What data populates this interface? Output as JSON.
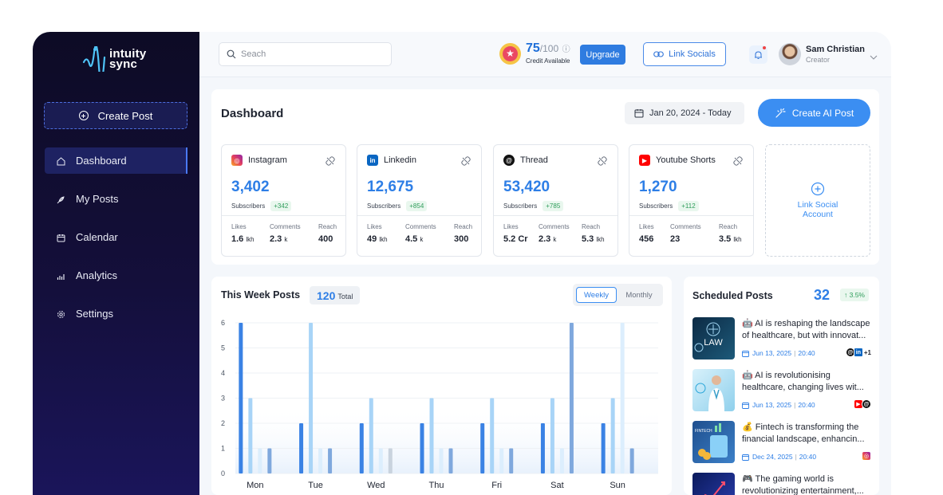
{
  "brand": {
    "name_line1": "intuity",
    "name_line2": "sync"
  },
  "sidebar": {
    "create_post_label": "Create Post",
    "items": [
      {
        "label": "Dashboard",
        "icon": "home-icon",
        "active": true
      },
      {
        "label": "My Posts",
        "icon": "feather-icon",
        "active": false
      },
      {
        "label": "Calendar",
        "icon": "calendar-icon",
        "active": false
      },
      {
        "label": "Analytics",
        "icon": "bar-chart-icon",
        "active": false
      },
      {
        "label": "Settings",
        "icon": "gear-icon",
        "active": false
      }
    ]
  },
  "header": {
    "search_placeholder": "Seach",
    "credits": {
      "value": "75",
      "total": "/100",
      "label": "Credit Available"
    },
    "upgrade_label": "Upgrade",
    "link_socials_label": "Link Socials",
    "user": {
      "name": "Sam Christian",
      "role": "Creator"
    }
  },
  "dashboard": {
    "title": "Dashboard",
    "date_range": "Jan 20, 2024 - Today",
    "create_ai_label": "Create AI Post",
    "link_social_label_1": "Link Social",
    "link_social_label_2": "Account",
    "cards": [
      {
        "platform": "Instagram",
        "icon": "instagram-icon",
        "color": "#e4405f",
        "count": "3,402",
        "sub": "Subscribers",
        "delta": "+342",
        "stats": [
          {
            "label": "Likes",
            "value": "1.6",
            "unit": "lkh"
          },
          {
            "label": "Comments",
            "value": "2.3",
            "unit": "k"
          },
          {
            "label": "Reach",
            "value": "400",
            "unit": ""
          }
        ]
      },
      {
        "platform": "Linkedin",
        "icon": "linkedin-icon",
        "color": "#0a66c2",
        "count": "12,675",
        "sub": "Subscribers",
        "delta": "+854",
        "stats": [
          {
            "label": "Likes",
            "value": "49",
            "unit": "lkh"
          },
          {
            "label": "Comments",
            "value": "4.5",
            "unit": "k"
          },
          {
            "label": "Reach",
            "value": "300",
            "unit": ""
          }
        ]
      },
      {
        "platform": "Thread",
        "icon": "threads-icon",
        "color": "#111111",
        "count": "53,420",
        "sub": "Subscribers",
        "delta": "+785",
        "stats": [
          {
            "label": "Likes",
            "value": "5.2 Cr",
            "unit": ""
          },
          {
            "label": "Comments",
            "value": "2.3",
            "unit": "k"
          },
          {
            "label": "Reach",
            "value": "5.3",
            "unit": "lkh"
          }
        ]
      },
      {
        "platform": "Youtube Shorts",
        "icon": "youtube-icon",
        "color": "#ff0000",
        "count": "1,270",
        "sub": "Subscribers",
        "delta": "+112",
        "stats": [
          {
            "label": "Likes",
            "value": "456",
            "unit": ""
          },
          {
            "label": "Comments",
            "value": "23",
            "unit": ""
          },
          {
            "label": "Reach",
            "value": "3.5",
            "unit": "lkh"
          }
        ]
      }
    ]
  },
  "week": {
    "title": "This Week Posts",
    "total_value": "120",
    "total_label": "Total",
    "tab_weekly": "Weekly",
    "tab_monthly": "Monthly"
  },
  "chart_data": {
    "type": "bar",
    "categories": [
      "Mon",
      "Tue",
      "Wed",
      "Thu",
      "Fri",
      "Sat",
      "Sun"
    ],
    "ylim": [
      0,
      6
    ],
    "yticks": [
      0,
      1,
      2,
      3,
      4,
      5,
      6
    ],
    "grid": true,
    "series": [
      {
        "color": "#3a82e4",
        "values": [
          6,
          2,
          2,
          2,
          2,
          2,
          2
        ]
      },
      {
        "color": "#a8d4f7",
        "values": [
          3,
          6,
          3,
          3,
          3,
          3,
          3
        ]
      },
      {
        "color": "#dceefd",
        "values": [
          1,
          1,
          1,
          1,
          1,
          1,
          6
        ]
      },
      {
        "color": "#7fa8dd",
        "values": [
          1,
          1,
          1,
          1,
          1,
          6,
          1
        ]
      }
    ],
    "wed_last_bar_color": "#c9d3de"
  },
  "scheduled": {
    "title": "Scheduled Posts",
    "count": "32",
    "delta": "↑ 3.5%",
    "posts": [
      {
        "line1": "🤖 AI is reshaping the landscape",
        "line2": "of healthcare, but with innovat...",
        "date": "Jun 13, 2025",
        "time": "20:40",
        "more": "+1"
      },
      {
        "line1": "🤖 AI is revolutionising",
        "line2": "healthcare, changing lives wit...",
        "date": "Jun 13, 2025",
        "time": "20:40",
        "more": ""
      },
      {
        "line1": "💰 Fintech is transforming the",
        "line2": "financial landscape, enhancin...",
        "date": "Dec 24, 2025",
        "time": "20:40",
        "more": ""
      },
      {
        "line1": "🎮 The gaming world is",
        "line2": "revolutionizing entertainment,...",
        "date": "",
        "time": "",
        "more": ""
      }
    ],
    "thumb_text_law": "LAW",
    "thumb_text_fintech": "FINTECH"
  }
}
